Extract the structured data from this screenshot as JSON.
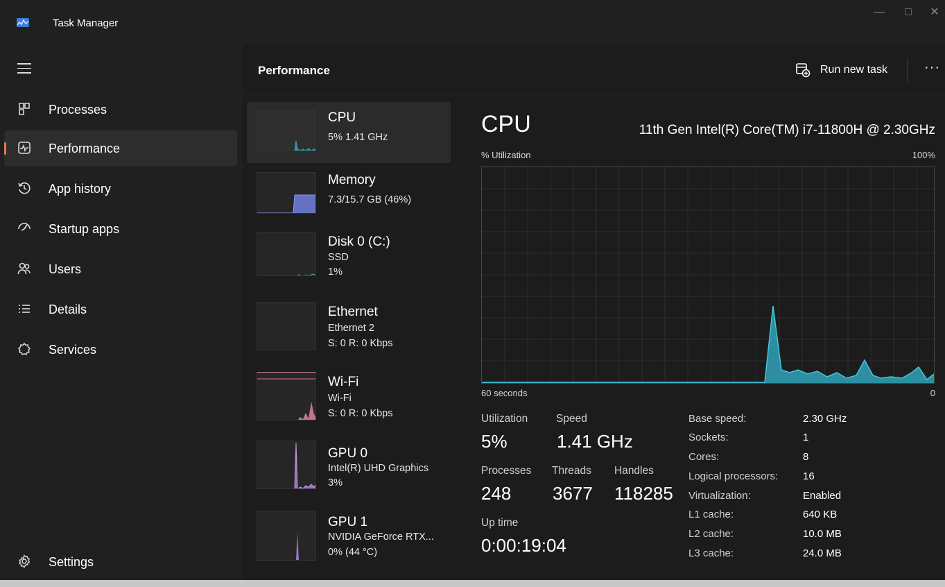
{
  "window": {
    "title": "Task Manager"
  },
  "sidebar": {
    "items": [
      {
        "label": "Processes",
        "icon": "processes-icon"
      },
      {
        "label": "Performance",
        "icon": "performance-icon",
        "active": true
      },
      {
        "label": "App history",
        "icon": "app-history-icon"
      },
      {
        "label": "Startup apps",
        "icon": "startup-apps-icon"
      },
      {
        "label": "Users",
        "icon": "users-icon"
      },
      {
        "label": "Details",
        "icon": "details-icon"
      },
      {
        "label": "Services",
        "icon": "services-icon"
      }
    ],
    "settings_label": "Settings"
  },
  "header": {
    "title": "Performance",
    "run_task_label": "Run new task",
    "more_label": "···"
  },
  "devices": [
    {
      "name": "CPU",
      "line1": "5% 1.41 GHz",
      "line2": "",
      "color": "#2fa3b8"
    },
    {
      "name": "Memory",
      "line1": "7.3/15.7 GB (46%)",
      "line2": "",
      "color": "#6f7ad6"
    },
    {
      "name": "Disk 0 (C:)",
      "line1": "SSD",
      "line2": "1%",
      "color": "#3ea08a"
    },
    {
      "name": "Ethernet",
      "line1": "Ethernet 2",
      "line2": "S: 0 R: 0 Kbps",
      "color": "#d47aa0"
    },
    {
      "name": "Wi-Fi",
      "line1": "Wi-Fi",
      "line2": "S: 0 R: 0 Kbps",
      "color": "#d47aa0"
    },
    {
      "name": "GPU 0",
      "line1": "Intel(R) UHD Graphics",
      "line2": "3%",
      "color": "#a77bcf"
    },
    {
      "name": "GPU 1",
      "line1": "NVIDIA GeForce RTX...",
      "line2": "0% (44 °C)",
      "color": "#a77bcf"
    }
  ],
  "detail": {
    "title": "CPU",
    "model": "11th Gen Intel(R) Core(TM) i7-11800H @ 2.30GHz",
    "util_label": "% Utilization",
    "util_max": "100%",
    "x_left": "60 seconds",
    "x_right": "0",
    "graph_color": "#2fa3b8",
    "utilization_label": "Utilization",
    "utilization_value": "5%",
    "speed_label": "Speed",
    "speed_value": "1.41 GHz",
    "processes_label": "Processes",
    "processes_value": "248",
    "threads_label": "Threads",
    "threads_value": "3677",
    "handles_label": "Handles",
    "handles_value": "118285",
    "uptime_label": "Up time",
    "uptime_value": "0:00:19:04",
    "specs": [
      {
        "label": "Base speed:",
        "value": "2.30 GHz"
      },
      {
        "label": "Sockets:",
        "value": "1"
      },
      {
        "label": "Cores:",
        "value": "8"
      },
      {
        "label": "Logical processors:",
        "value": "16"
      },
      {
        "label": "Virtualization:",
        "value": "Enabled"
      },
      {
        "label": "L1 cache:",
        "value": "640 KB"
      },
      {
        "label": "L2 cache:",
        "value": "10.0 MB"
      },
      {
        "label": "L3 cache:",
        "value": "24.0 MB"
      }
    ]
  }
}
